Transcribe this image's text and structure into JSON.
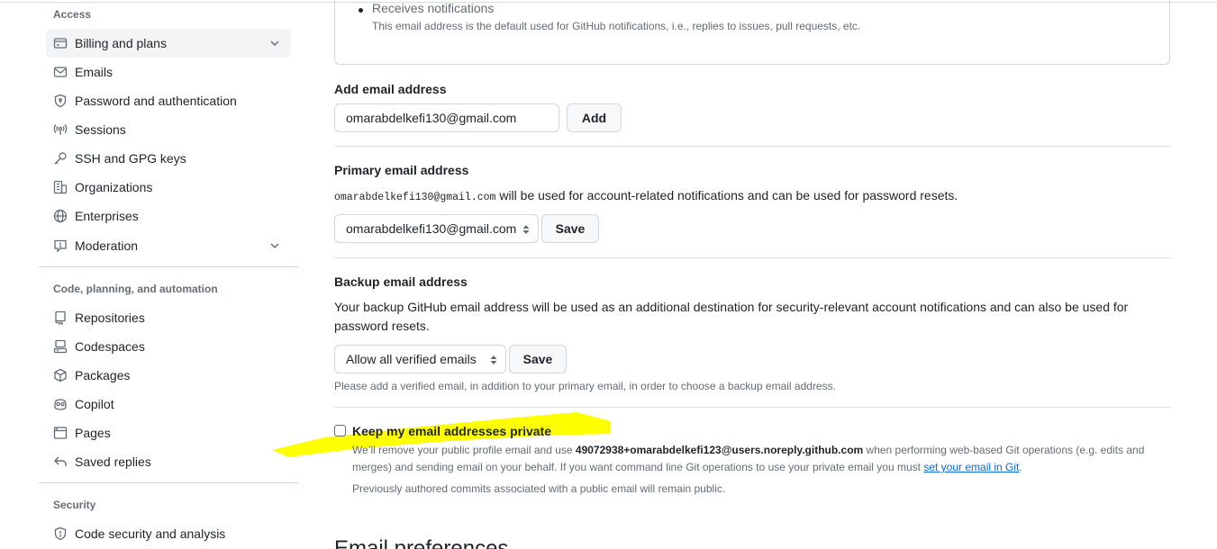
{
  "sidebar": {
    "access_heading": "Access",
    "access_items": [
      {
        "label": "Billing and plans",
        "icon": "credit-card-icon"
      },
      {
        "label": "Emails",
        "icon": "mail-icon"
      },
      {
        "label": "Password and authentication",
        "icon": "shield-lock-icon"
      },
      {
        "label": "Sessions",
        "icon": "broadcast-icon"
      },
      {
        "label": "SSH and GPG keys",
        "icon": "key-icon"
      },
      {
        "label": "Organizations",
        "icon": "organization-icon"
      },
      {
        "label": "Enterprises",
        "icon": "globe-icon"
      },
      {
        "label": "Moderation",
        "icon": "report-icon"
      }
    ],
    "code_heading": "Code, planning, and automation",
    "code_items": [
      {
        "label": "Repositories",
        "icon": "repo-icon"
      },
      {
        "label": "Codespaces",
        "icon": "codespaces-icon"
      },
      {
        "label": "Packages",
        "icon": "package-icon"
      },
      {
        "label": "Copilot",
        "icon": "copilot-icon"
      },
      {
        "label": "Pages",
        "icon": "browser-icon"
      },
      {
        "label": "Saved replies",
        "icon": "reply-icon"
      }
    ],
    "security_heading": "Security",
    "security_items": [
      {
        "label": "Code security and analysis",
        "icon": "shield-icon"
      }
    ]
  },
  "main": {
    "receives_title": "Receives notifications",
    "receives_desc": "This email address is the default used for GitHub notifications, i.e., replies to issues, pull requests, etc.",
    "add_email": {
      "heading": "Add email address",
      "input_value": "omarabdelkefi130@gmail.com",
      "button": "Add"
    },
    "primary_email": {
      "heading": "Primary email address",
      "email_mono": "omarabdelkefi130@gmail.com",
      "desc_rest": " will be used for account-related notifications and can be used for password resets.",
      "selected": "omarabdelkefi130@gmail.com",
      "button": "Save"
    },
    "backup_email": {
      "heading": "Backup email address",
      "desc": "Your backup GitHub email address will be used as an additional destination for security-relevant account notifications and can also be used for password resets.",
      "selected": "Allow all verified emails",
      "button": "Save",
      "note": "Please add a verified email, in addition to your primary email, in order to choose a backup email address."
    },
    "keep_private": {
      "label": "Keep my email addresses private",
      "checked": false,
      "desc_prefix": "We’ll remove your public profile email and use ",
      "noreply": "49072938+omarabdelkefi123@users.noreply.github.com",
      "desc_middle": " when performing web-based Git operations (e.g. edits and merges) and sending email on your behalf. If you want command line Git operations to use your private email you must ",
      "link": "set your email in Git",
      "desc_suffix": ".",
      "note": "Previously authored commits associated with a public email will remain public."
    },
    "email_prefs_heading": "Email preferences"
  },
  "colors": {
    "highlight": "#ffff00",
    "link": "#0969da",
    "muted": "#636c76"
  }
}
